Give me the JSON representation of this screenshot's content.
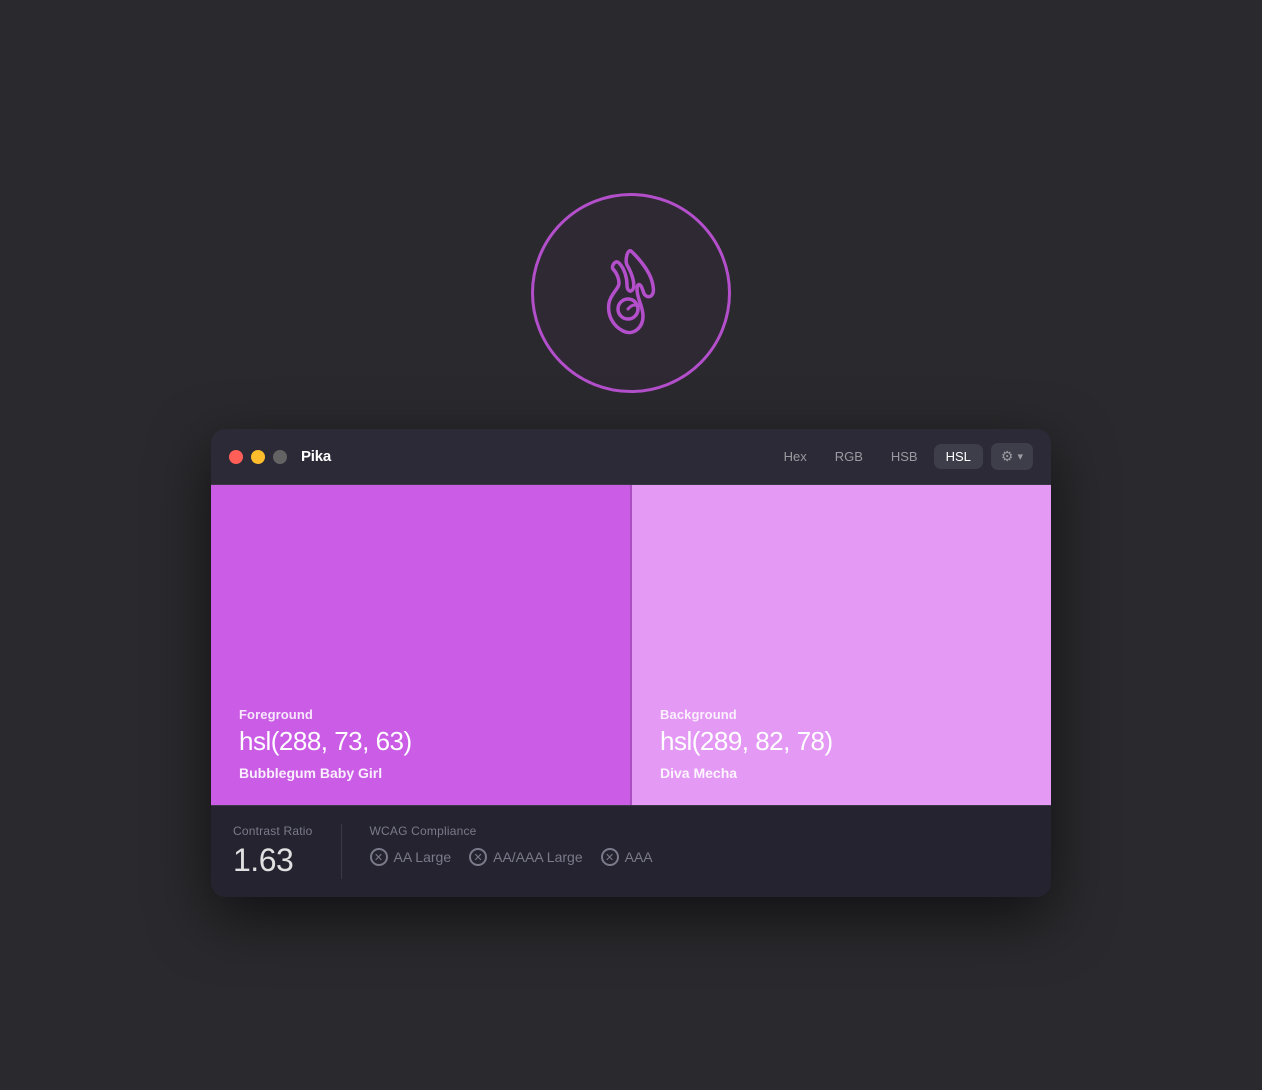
{
  "app": {
    "icon_label": "Pika app icon",
    "title": "Pika"
  },
  "titlebar": {
    "title": "Pika",
    "traffic_lights": {
      "red": "close",
      "yellow": "minimize",
      "gray": "zoom"
    },
    "format_tabs": [
      {
        "label": "Hex",
        "active": false
      },
      {
        "label": "RGB",
        "active": false
      },
      {
        "label": "HSB",
        "active": false
      },
      {
        "label": "HSL",
        "active": true
      }
    ],
    "settings_label": "⚙",
    "settings_chevron": "∨"
  },
  "foreground": {
    "label": "Foreground",
    "value": "hsl(288, 73, 63)",
    "name": "Bubblegum Baby Girl"
  },
  "background": {
    "label": "Background",
    "value": "hsl(289, 82, 78)",
    "name": "Diva Mecha"
  },
  "contrast": {
    "label": "Contrast Ratio",
    "value": "1.63"
  },
  "wcag": {
    "label": "WCAG Compliance",
    "badges": [
      {
        "label": "AA Large"
      },
      {
        "label": "AA/AAA Large"
      },
      {
        "label": "AAA"
      }
    ]
  }
}
